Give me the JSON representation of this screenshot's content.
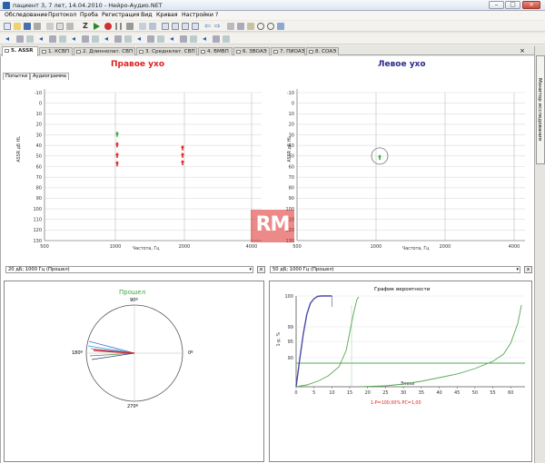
{
  "window": {
    "title": "пациент 3, 7 лет, 14.04.2010 - Нейро-Аудио.NET",
    "min": "–",
    "max": "▢",
    "close": "×"
  },
  "menu": [
    "Обследование",
    "Протокол",
    "Проба",
    "Регистрация",
    "Вид",
    "Кривая",
    "Настройки",
    "?"
  ],
  "toolbar_icons_row1": [
    "new-icon",
    "open-icon",
    "save-icon",
    "print-icon",
    "cut-icon",
    "paste-icon",
    "tool-icon",
    "z-icon",
    "play-icon",
    "record-icon",
    "pause-icon",
    "stop-icon",
    "list-icon",
    "grid-icon",
    "doc-icon",
    "doc2-icon",
    "doc3-icon",
    "doc4-icon",
    "back-icon",
    "forward-icon",
    "undo-icon",
    "calc-icon",
    "ruler-icon",
    "zoom-icon",
    "mag-icon",
    "chart-icon"
  ],
  "tabs": [
    {
      "label": "5. ASSR",
      "active": true
    },
    {
      "label": "1. КСВП",
      "active": false
    },
    {
      "label": "2. Длиннолат. СВП",
      "active": false
    },
    {
      "label": "3. Среднелат. СВП",
      "active": false
    },
    {
      "label": "4. ВМВП",
      "active": false
    },
    {
      "label": "6. ЗВОАЭ",
      "active": false
    },
    {
      "label": "7. ПИОАЭ",
      "active": false
    },
    {
      "label": "8. СОАЭ",
      "active": false
    }
  ],
  "side_panel": {
    "label": "Монитор исследования"
  },
  "subtabs": [
    "Попытки",
    "Аудиограмма"
  ],
  "right_ear": {
    "title": "Правое ухо",
    "color": "#e02020"
  },
  "left_ear": {
    "title": "Левое ухо",
    "color": "#2a2a8a"
  },
  "audiogram_axis": {
    "y_ticks": [
      "-10",
      "0",
      "10",
      "20",
      "30",
      "40",
      "50",
      "60",
      "70",
      "80",
      "90",
      "100",
      "110",
      "120",
      "130"
    ],
    "x_ticks": [
      "500",
      "1000",
      "2000",
      "4000"
    ],
    "ylabel": "ASSR дБ HL",
    "xlabel": "Частота, Гц"
  },
  "right_combo": "20 дБ; 1000 Гц (Прошел)",
  "left_combo": "50 дБ; 1000 Гц (Прошел)",
  "x_button": "x",
  "polar": {
    "title": "Прошел",
    "title_color": "#3aa83a",
    "label_top": "90º",
    "label_left": "180º",
    "label_right": "0º",
    "label_bottom": "270º"
  },
  "chart_data": {
    "type": "line",
    "title": "График вероятности",
    "xlabel": "Эпохи",
    "ylabel": "1-p, %",
    "x_ticks": [
      "0",
      "5",
      "10",
      "15",
      "20",
      "25",
      "30",
      "35",
      "40",
      "45",
      "50",
      "55",
      "60"
    ],
    "y_ticks": [
      "90",
      "95",
      "99",
      "100"
    ],
    "xlim": [
      0,
      64
    ],
    "series": [
      {
        "color": "#4a4aa8",
        "x": [
          0,
          1,
          2,
          3,
          4,
          5,
          6,
          7,
          8,
          9,
          10
        ],
        "y": [
          0,
          30,
          58,
          80,
          92,
          97,
          99.5,
          100,
          100,
          100,
          100
        ]
      },
      {
        "color": "#55a855",
        "x": [
          0,
          3,
          6,
          9,
          12,
          14,
          15,
          16,
          17,
          17.5
        ],
        "y": [
          0,
          2,
          6,
          12,
          22,
          40,
          60,
          80,
          96,
          99
        ]
      },
      {
        "color": "#55a855",
        "x": [
          18,
          25,
          30,
          35,
          40,
          45,
          50,
          55,
          58,
          60,
          62,
          63
        ],
        "y": [
          0,
          1,
          3,
          6,
          10,
          14,
          20,
          28,
          36,
          48,
          70,
          90
        ]
      }
    ],
    "footer": "1-P=100,00%   PC=1,00"
  }
}
